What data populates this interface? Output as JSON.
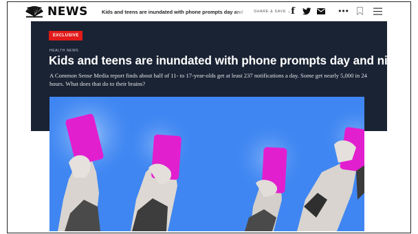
{
  "header": {
    "logo_text": "NEWS",
    "article_title": "Kids and teens are inundated with phone prompts day and night",
    "share_label": "SHARE & SAVE ⌄",
    "icons": [
      "nbc-peacock-icon",
      "facebook-icon",
      "twitter-icon",
      "mail-icon",
      "more-icon",
      "bookmark-icon",
      "menu-icon"
    ]
  },
  "article": {
    "badge": "EXCLUSIVE",
    "section": "HEALTH NEWS",
    "headline": "Kids and teens are inundated with phone prompts day and night",
    "dek": "A Common Sense Media report finds about half of 11- to 17-year-olds get at least 237 notifications a day. Some get nearly 5,000 in 24 hours. What does that do to their brains?"
  },
  "colors": {
    "hero_bg": "#1a2333",
    "badge": "#e21a1a",
    "photo_bg": "#3f86f2",
    "phone": "#e21fcf"
  }
}
